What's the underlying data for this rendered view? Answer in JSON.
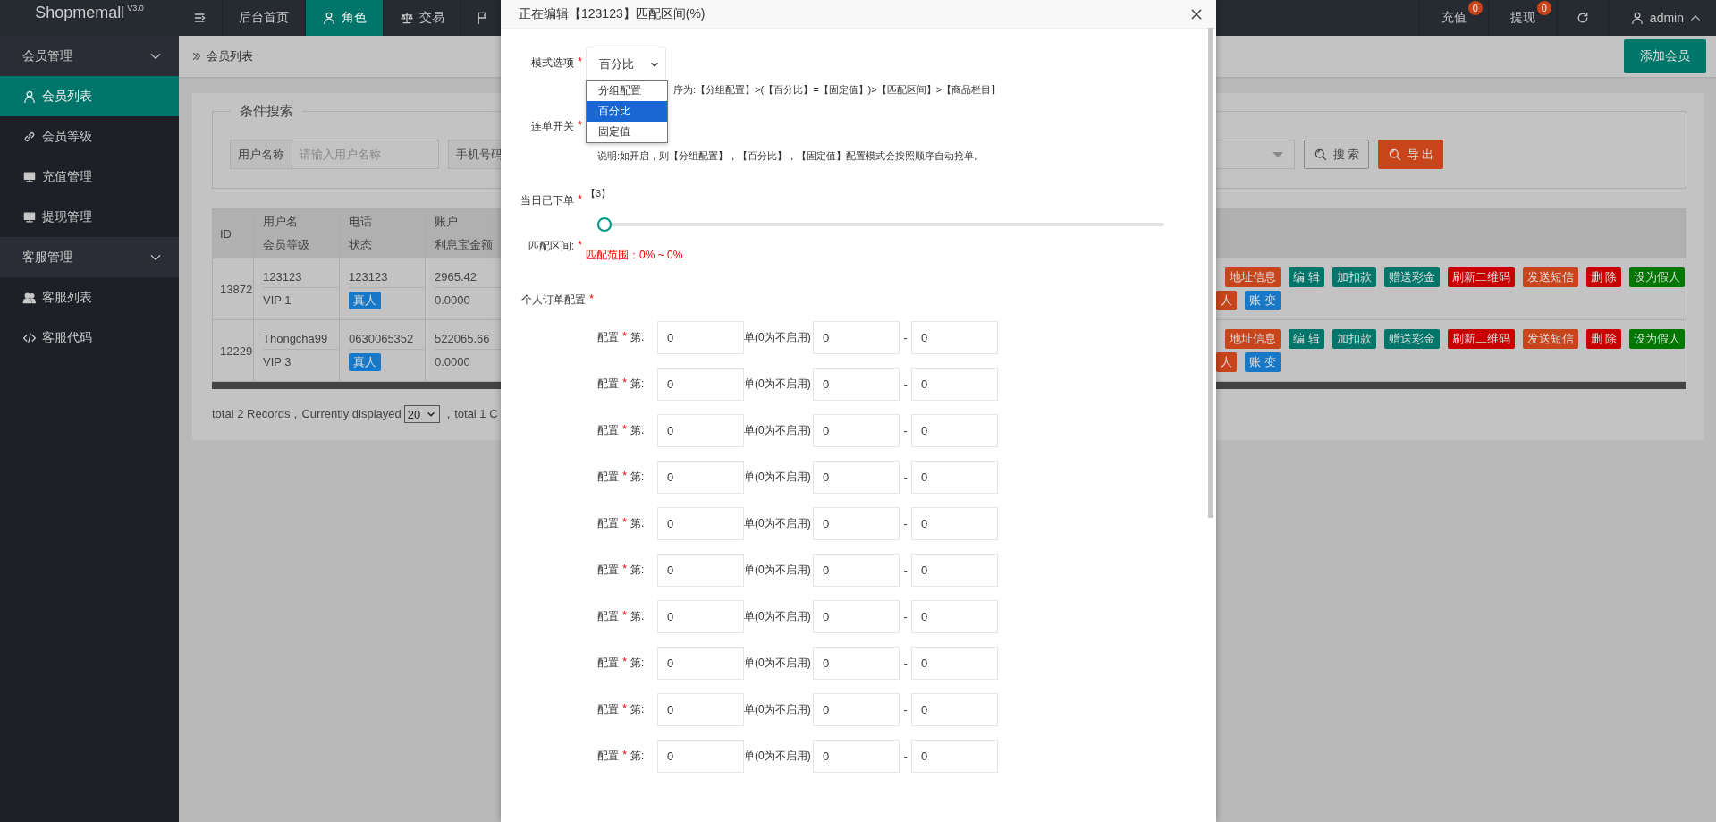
{
  "header": {
    "logo": "Shopmemall",
    "version": "V3.0",
    "nav": [
      {
        "kind": "menu",
        "selected": false
      },
      {
        "kind": "text",
        "label": "后台首页",
        "selected": false
      },
      {
        "kind": "user",
        "label": "角色",
        "selected": true
      },
      {
        "kind": "scale",
        "label": "交易",
        "selected": false
      },
      {
        "kind": "flag",
        "selected": false
      }
    ],
    "right": [
      {
        "kind": "badge",
        "label": "充值",
        "badge": "0"
      },
      {
        "kind": "badge",
        "label": "提现",
        "badge": "0"
      },
      {
        "kind": "refresh"
      },
      {
        "kind": "user",
        "label": "admin"
      }
    ]
  },
  "sidebar": [
    {
      "label": "会员管理",
      "expanded": true,
      "children": [
        {
          "kind": "user",
          "label": "会员列表",
          "selected": true
        },
        {
          "kind": "link",
          "label": "会员等级",
          "selected": false
        },
        {
          "kind": "monitor",
          "label": "充值管理",
          "selected": false
        },
        {
          "kind": "monitor",
          "label": "提现管理",
          "selected": false
        }
      ]
    },
    {
      "label": "客服管理",
      "expanded": true,
      "children": [
        {
          "kind": "users",
          "label": "客服列表",
          "selected": false
        },
        {
          "kind": "code",
          "label": "客服代码",
          "selected": false
        }
      ]
    }
  ],
  "content": {
    "breadcrumb": "会员列表",
    "add_button": "添加会员",
    "search": {
      "legend": "条件搜索",
      "fields": [
        {
          "label": "用户名称",
          "placeholder": "请输入用户名称"
        },
        {
          "label": "手机号码"
        }
      ],
      "buttons": [
        {
          "kind": "default",
          "label": "搜 索"
        },
        {
          "kind": "danger",
          "label": "导 出"
        }
      ]
    },
    "table": {
      "columns": [
        [
          "ID"
        ],
        [
          "用户名",
          "会员等级"
        ],
        [
          "电话",
          "状态"
        ],
        [
          "账户",
          "利息宝金额"
        ]
      ],
      "rows": [
        {
          "id": "13872",
          "username": "123123",
          "level": "VIP 1",
          "phone": "123123",
          "status": "真人",
          "balance": "2965.42",
          "interest": "0.0000",
          "actions": [
            [
              {
                "label": "地址信息",
                "color": "#c8441b"
              },
              {
                "label": "编 辑",
                "color": "#00766a"
              },
              {
                "label": "加扣款",
                "color": "#00766a"
              },
              {
                "label": "赠送彩金",
                "color": "#00766a"
              },
              {
                "label": "刷新二维码",
                "color": "#c80000"
              },
              {
                "label": "发送短信",
                "color": "#c8441b"
              },
              {
                "label": "删 除",
                "color": "#c80000"
              },
              {
                "label": "设为假人",
                "color": "#007800"
              }
            ],
            [
              {
                "label": "人",
                "color": "#c8441b"
              },
              {
                "label": "账 变",
                "color": "#1878c8"
              }
            ]
          ]
        },
        {
          "id": "12229",
          "username": "Thongcha99",
          "level": "VIP 3",
          "phone": "0630065352",
          "status": "真人",
          "balance": "522065.66",
          "interest": "0.0000",
          "actions": [
            [
              {
                "label": "地址信息",
                "color": "#c8441b"
              },
              {
                "label": "编 辑",
                "color": "#00766a"
              },
              {
                "label": "加扣款",
                "color": "#00766a"
              },
              {
                "label": "赠送彩金",
                "color": "#00766a"
              },
              {
                "label": "刷新二维码",
                "color": "#c80000"
              },
              {
                "label": "发送短信",
                "color": "#c8441b"
              },
              {
                "label": "删 除",
                "color": "#c80000"
              },
              {
                "label": "设为假人",
                "color": "#007800"
              }
            ],
            [
              {
                "label": "人",
                "color": "#c8441b"
              },
              {
                "label": "账 变",
                "color": "#1878c8"
              }
            ]
          ]
        }
      ]
    },
    "footer": {
      "before": "total 2 Records，Currently displayed",
      "page_size": "20",
      "after": "，total 1 C"
    }
  },
  "modal": {
    "title": "正在编辑【123123】匹配区间(%)",
    "mode": {
      "label": "模式选项",
      "mark": "*",
      "value": "百分比",
      "expanded": true,
      "options": [
        {
          "label": "分组配置",
          "selected": false
        },
        {
          "label": "百分比",
          "selected": true
        },
        {
          "label": "固定值",
          "selected": false
        }
      ],
      "hint": "序为:【分组配置】>(【百分比】=【固定值】)>【匹配区间】>【商品栏目】"
    },
    "chain": {
      "label": "连单开关",
      "mark": "*",
      "note": "说明:如开启，则【分组配置】，【百分比】，【固定值】配置模式会按照顺序自动抢单。"
    },
    "today": {
      "label": "当日已下单",
      "mark": "*",
      "value": "【3】"
    },
    "range": {
      "label": "匹配区间:",
      "mark": "*",
      "level": 0,
      "reading": "匹配范围：0% ~ 0%"
    },
    "orders": {
      "label": "个人订单配置",
      "mark": "*",
      "rows": [
        {
          "label": "配置",
          "mark": "*",
          "prefix": "第:",
          "count": "0",
          "unit": "单(0为不启用)",
          "min": "0",
          "sep": "-",
          "max": "0"
        },
        {
          "label": "配置",
          "mark": "*",
          "prefix": "第:",
          "count": "0",
          "unit": "单(0为不启用)",
          "min": "0",
          "sep": "-",
          "max": "0"
        },
        {
          "label": "配置",
          "mark": "*",
          "prefix": "第:",
          "count": "0",
          "unit": "单(0为不启用)",
          "min": "0",
          "sep": "-",
          "max": "0"
        },
        {
          "label": "配置",
          "mark": "*",
          "prefix": "第:",
          "count": "0",
          "unit": "单(0为不启用)",
          "min": "0",
          "sep": "-",
          "max": "0"
        },
        {
          "label": "配置",
          "mark": "*",
          "prefix": "第:",
          "count": "0",
          "unit": "单(0为不启用)",
          "min": "0",
          "sep": "-",
          "max": "0"
        },
        {
          "label": "配置",
          "mark": "*",
          "prefix": "第:",
          "count": "0",
          "unit": "单(0为不启用)",
          "min": "0",
          "sep": "-",
          "max": "0"
        },
        {
          "label": "配置",
          "mark": "*",
          "prefix": "第:",
          "count": "0",
          "unit": "单(0为不启用)",
          "min": "0",
          "sep": "-",
          "max": "0"
        },
        {
          "label": "配置",
          "mark": "*",
          "prefix": "第:",
          "count": "0",
          "unit": "单(0为不启用)",
          "min": "0",
          "sep": "-",
          "max": "0"
        },
        {
          "label": "配置",
          "mark": "*",
          "prefix": "第:",
          "count": "0",
          "unit": "单(0为不启用)",
          "min": "0",
          "sep": "-",
          "max": "0"
        },
        {
          "label": "配置",
          "mark": "*",
          "prefix": "第:",
          "count": "0",
          "unit": "单(0为不启用)",
          "min": "0",
          "sep": "-",
          "max": "0"
        }
      ]
    }
  }
}
